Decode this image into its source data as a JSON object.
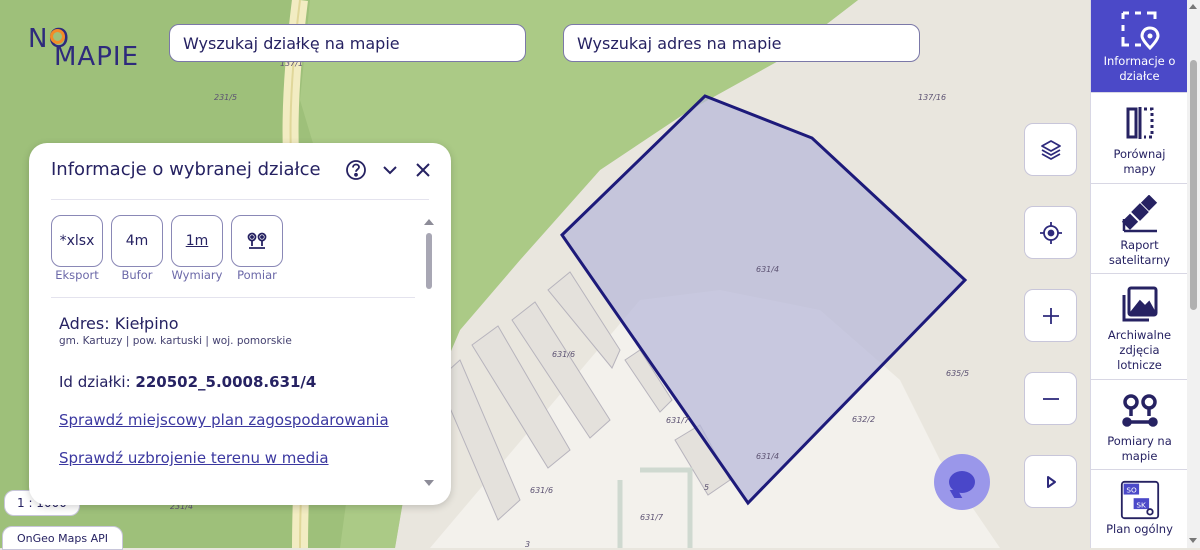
{
  "logo": {
    "top": "NO",
    "bottom": "MAPIE"
  },
  "search": {
    "plot_placeholder": "Wyszukaj działkę na mapie",
    "address_placeholder": "Wyszukaj adres na mapie"
  },
  "map": {
    "parcel_labels": [
      "231/5",
      "137/1",
      "137/16",
      "631/4",
      "631/6",
      "631/7",
      "632/2",
      "635/5",
      "631/4",
      "631/6",
      "231/4",
      "631/7",
      "5",
      "3"
    ],
    "selected_parcel_color": "#1d1a7a",
    "scale_label": "1 : 1000",
    "attribution": "OnGeo Maps API"
  },
  "panel": {
    "title": "Informacje o wybranej działce",
    "tools": [
      {
        "icon": "*xlsx",
        "label": "Eksport"
      },
      {
        "icon": "4m",
        "label": "Bufor"
      },
      {
        "icon": "1m",
        "label": "Wymiary"
      },
      {
        "icon": "pins-icon",
        "label": "Pomiar"
      }
    ],
    "address_title": "Adres: Kiełpino",
    "address_sub": "gm. Kartuzy | pow. kartuski | woj. pomorskie",
    "plot_id_label": "Id działki:",
    "plot_id_value": "220502_5.0008.631/4",
    "link_plan": "Sprawdź miejscowy plan zagospodarowania",
    "link_media": "Sprawdź uzbrojenie terenu w media"
  },
  "sidebar": {
    "items": [
      {
        "label": "Informacje o\ndziałce",
        "active": true
      },
      {
        "label": "Porównaj\nmapy",
        "active": false
      },
      {
        "label": "Raport\nsatelitarny",
        "active": false
      },
      {
        "label": "Archiwalne\nzdjęcia\nlotnicze",
        "active": false
      },
      {
        "label": "Pomiary na\nmapie",
        "active": false
      },
      {
        "label": "Plan ogólny",
        "active": false
      }
    ]
  },
  "colors": {
    "accent": "#4b49c8",
    "brand": "#2e2a7c",
    "logo_accent": "#f28c28"
  }
}
